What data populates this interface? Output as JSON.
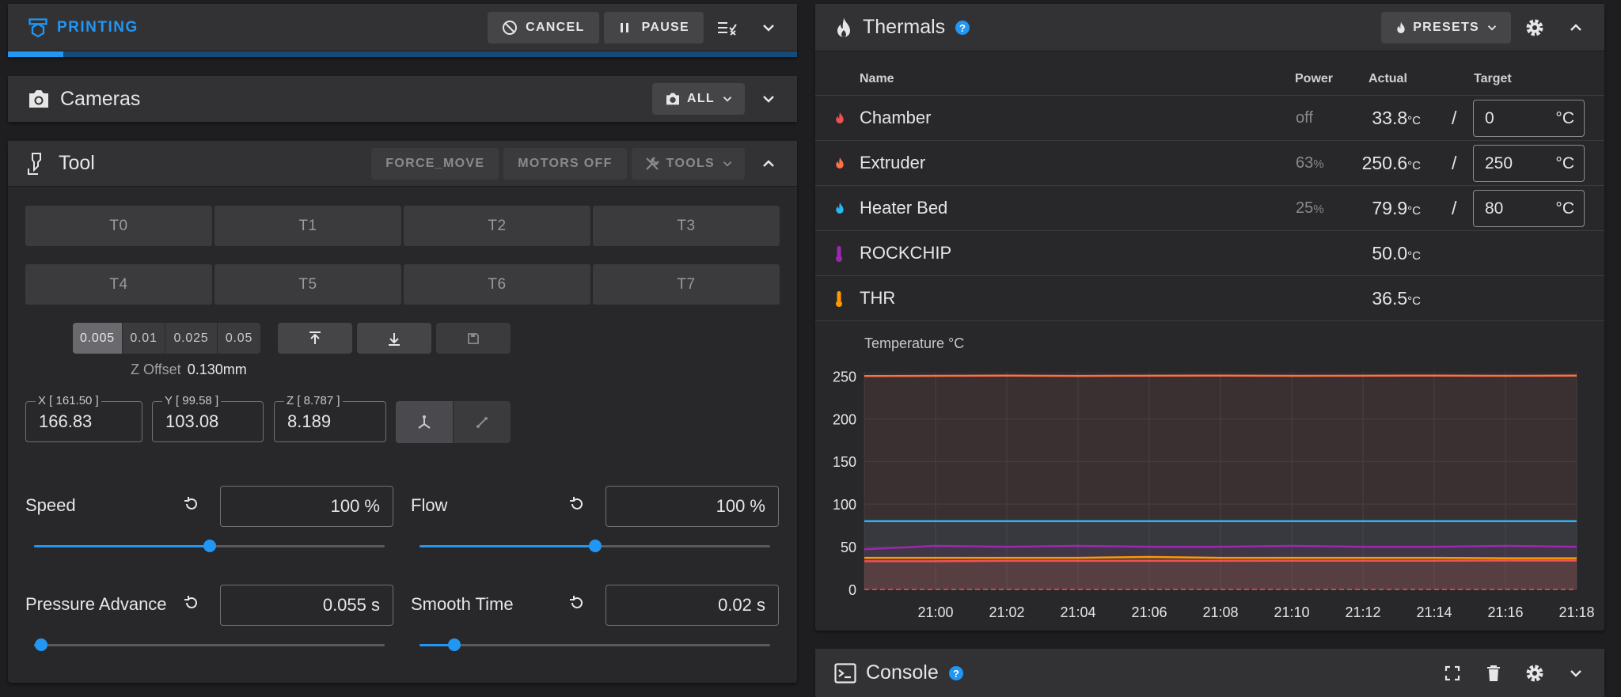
{
  "printing": {
    "status": "PRINTING",
    "cancel": "CANCEL",
    "pause": "PAUSE",
    "progress": 0.07
  },
  "cameras": {
    "title": "Cameras",
    "filter": "ALL"
  },
  "tool": {
    "title": "Tool",
    "force_move": "FORCE_MOVE",
    "motors_off": "MOTORS OFF",
    "tools": "TOOLS",
    "toolheads_row1": [
      "T0",
      "T1",
      "T2",
      "T3"
    ],
    "toolheads_row2": [
      "T4",
      "T5",
      "T6",
      "T7"
    ],
    "z_steps": [
      "0.005",
      "0.01",
      "0.025",
      "0.05"
    ],
    "z_step_selected": "0.005",
    "z_offset_label": "Z Offset",
    "z_offset_value": "0.130mm",
    "x_label": "X [ 161.50 ]",
    "x_value": "166.83",
    "y_label": "Y [ 99.58 ]",
    "y_value": "103.08",
    "z_label": "Z [ 8.787 ]",
    "z_value": "8.189",
    "speed": {
      "label": "Speed",
      "value": "100 %",
      "level": 0.5
    },
    "flow": {
      "label": "Flow",
      "value": "100 %",
      "level": 0.5
    },
    "pressure_advance": {
      "label": "Pressure Advance",
      "value": "0.055 s",
      "level": 0.02
    },
    "smooth_time": {
      "label": "Smooth Time",
      "value": "0.02 s",
      "level": 0.1
    }
  },
  "thermals": {
    "title": "Thermals",
    "presets": "PRESETS",
    "headers": {
      "name": "Name",
      "power": "Power",
      "actual": "Actual",
      "target": "Target"
    },
    "rows": [
      {
        "name": "Chamber",
        "power": "off",
        "power_unit": "",
        "actual": "33.8",
        "unit": "°C",
        "target": "0",
        "target_unit": "°C",
        "color": "#ef5350"
      },
      {
        "name": "Extruder",
        "power": "63",
        "power_unit": "%",
        "actual": "250.6",
        "unit": "°C",
        "target": "250",
        "target_unit": "°C",
        "color": "#ff7043"
      },
      {
        "name": "Heater Bed",
        "power": "25",
        "power_unit": "%",
        "actual": "79.9",
        "unit": "°C",
        "target": "80",
        "target_unit": "°C",
        "color": "#29b6f6"
      },
      {
        "name": "ROCKCHIP",
        "power": "",
        "power_unit": "",
        "actual": "50.0",
        "unit": "°C",
        "color": "#9c27b0"
      },
      {
        "name": "THR",
        "power": "",
        "power_unit": "",
        "actual": "36.5",
        "unit": "°C",
        "color": "#ff9800"
      }
    ]
  },
  "chart_data": {
    "type": "line",
    "title": "Temperature °C",
    "ylim": [
      0,
      255
    ],
    "yticks": [
      "0",
      "50",
      "100",
      "150",
      "200",
      "250"
    ],
    "x": [
      "20:59",
      "21:00",
      "21:02",
      "21:04",
      "21:06",
      "21:08",
      "21:10",
      "21:12",
      "21:14",
      "21:16",
      "21:18"
    ],
    "xticks": [
      "21:00",
      "21:02",
      "21:04",
      "21:06",
      "21:08",
      "21:10",
      "21:12",
      "21:14",
      "21:16",
      "21:18"
    ],
    "series": [
      {
        "color": "#ff7043",
        "values": [
          250.2,
          250.4,
          250.6,
          250.3,
          250.5,
          250.6,
          250.4,
          250.5,
          250.6,
          250.4,
          250.6
        ]
      },
      {
        "color": "#29b6f6",
        "values": [
          80.0,
          79.9,
          80.0,
          79.9,
          80.0,
          79.9,
          80.0,
          79.9,
          80.0,
          79.9,
          79.9
        ]
      },
      {
        "color": "#9c27b0",
        "values": [
          47,
          51,
          50,
          51,
          50,
          50,
          51,
          50,
          50,
          51,
          50
        ]
      },
      {
        "color": "#ff9800",
        "values": [
          37,
          37,
          37,
          37,
          38,
          37,
          37,
          37,
          37,
          36.5,
          36.5
        ]
      },
      {
        "color": "#ef5350",
        "values": [
          33,
          33,
          33.5,
          33.5,
          33.5,
          33.5,
          33.6,
          33.6,
          33.7,
          33.8,
          33.8
        ]
      },
      {
        "color": "#ef5350",
        "dashed": true,
        "values": [
          0,
          0,
          0,
          0,
          0,
          0,
          0,
          0,
          0,
          0,
          0
        ]
      }
    ]
  },
  "console": {
    "title": "Console"
  }
}
